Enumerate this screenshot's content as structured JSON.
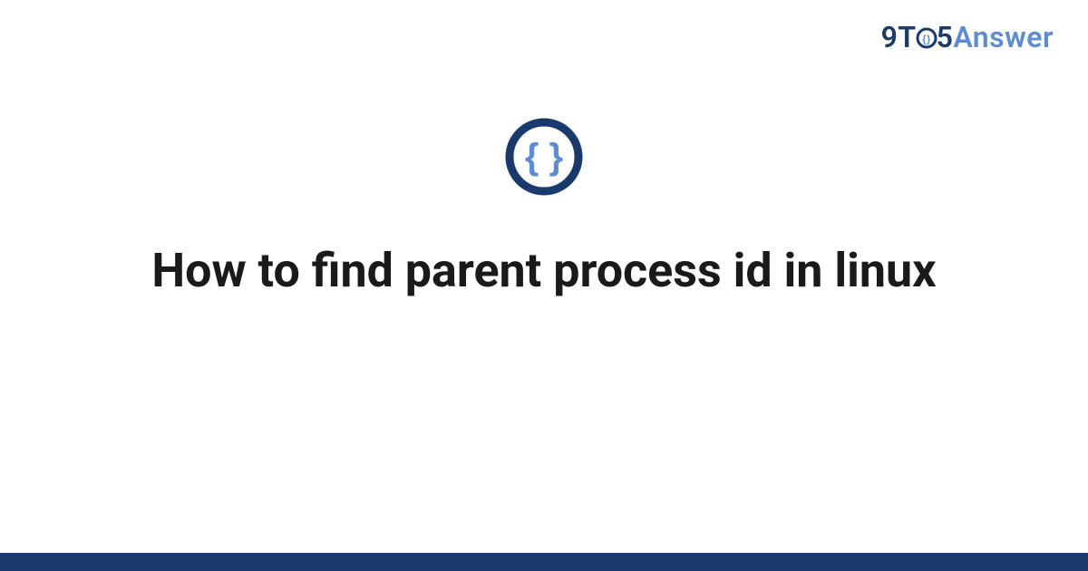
{
  "brand": {
    "nine": "9",
    "t": "T",
    "five": "5",
    "answer": "Answer"
  },
  "title": "How to find parent process id in linux",
  "colors": {
    "brand_dark": "#1a3a6e",
    "brand_light": "#5b8dd6",
    "icon_inner": "#5b8dd6",
    "icon_ring": "#1a3a6e"
  }
}
